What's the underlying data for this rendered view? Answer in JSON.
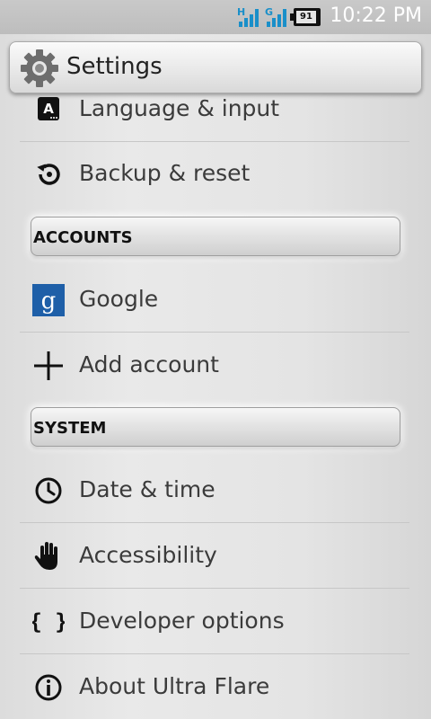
{
  "status_bar": {
    "time": "10:22 PM",
    "battery_level": "91",
    "network_labels": [
      "H",
      "G"
    ]
  },
  "title_bar": {
    "title": "Settings",
    "icon": "gear-icon"
  },
  "items": [
    {
      "label": "Language & input",
      "icon": "language-icon"
    },
    {
      "label": "Backup & reset",
      "icon": "backup-icon"
    },
    {
      "label": "Google",
      "icon": "google-icon"
    },
    {
      "label": "Add account",
      "icon": "plus-icon"
    },
    {
      "label": "Date & time",
      "icon": "clock-icon"
    },
    {
      "label": "Accessibility",
      "icon": "hand-icon"
    },
    {
      "label": "Developer options",
      "icon": "braces-icon"
    },
    {
      "label": "About Ultra Flare",
      "icon": "info-icon"
    }
  ],
  "headers": {
    "accounts": "ACCOUNTS",
    "system": "SYSTEM"
  },
  "colors": {
    "google_blue": "#1e5fa8",
    "status_icons": "#1a8fc9"
  }
}
